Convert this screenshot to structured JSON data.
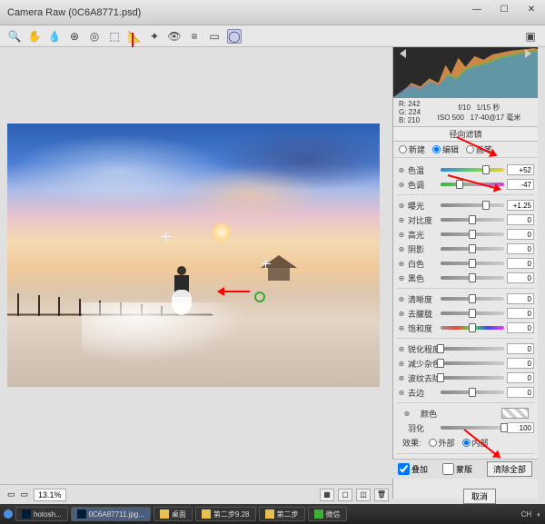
{
  "window": {
    "title": "Camera Raw (0C6A8771.psd)"
  },
  "toolbar_icons": [
    "magnify",
    "hand",
    "eyedrop",
    "sampler",
    "target",
    "crop",
    "straighten",
    "spot",
    "redeye",
    "adjust",
    "graduated",
    "radial"
  ],
  "rgb_readout": {
    "R": "242",
    "G": "224",
    "B": "210"
  },
  "exif": {
    "aperture": "f/10",
    "shutter": "1/15 秒",
    "iso": "ISO 500",
    "lens": "17-40@17 毫米"
  },
  "panel_title": "径向滤镜",
  "mode_row": {
    "new": "新建",
    "edit": "编辑",
    "brush": "画笔",
    "selected": "编辑"
  },
  "groups": [
    {
      "rows": [
        {
          "label": "色温",
          "value": "+52",
          "pos": 72,
          "track": "temp"
        },
        {
          "label": "色调",
          "value": "-47",
          "pos": 30,
          "track": "tint"
        }
      ]
    },
    {
      "rows": [
        {
          "label": "曝光",
          "value": "+1.25",
          "pos": 72
        },
        {
          "label": "对比度",
          "value": "0",
          "pos": 50
        },
        {
          "label": "高光",
          "value": "0",
          "pos": 50
        },
        {
          "label": "阴影",
          "value": "0",
          "pos": 50
        },
        {
          "label": "白色",
          "value": "0",
          "pos": 50
        },
        {
          "label": "黑色",
          "value": "0",
          "pos": 50
        }
      ]
    },
    {
      "rows": [
        {
          "label": "清晰度",
          "value": "0",
          "pos": 50
        },
        {
          "label": "去朦胧",
          "value": "0",
          "pos": 50
        },
        {
          "label": "饱和度",
          "value": "0",
          "pos": 50,
          "track": "sat"
        }
      ]
    },
    {
      "rows": [
        {
          "label": "锐化程度",
          "value": "0",
          "pos": 0
        },
        {
          "label": "减少杂色",
          "value": "0",
          "pos": 0
        },
        {
          "label": "波纹去除",
          "value": "0",
          "pos": 0
        },
        {
          "label": "去边",
          "value": "0",
          "pos": 50
        }
      ]
    }
  ],
  "color_sel": {
    "label": "颜色"
  },
  "feather": {
    "label": "羽化",
    "value": "100",
    "pos": 100
  },
  "effect_row": {
    "label": "效果:",
    "outside": "外部",
    "inside": "内部",
    "selected": "内部"
  },
  "footer": {
    "overlay": "叠加",
    "mask": "蒙版",
    "clear_all": "清除全部"
  },
  "zoom": "13.1%",
  "action_btn": "取消",
  "taskbar": {
    "items": [
      "hotosh...",
      "0C6A87711.jpg...",
      "桌面",
      "第二步9.28",
      "第二步",
      "微信"
    ],
    "tray": [
      "CH",
      "◐"
    ]
  }
}
